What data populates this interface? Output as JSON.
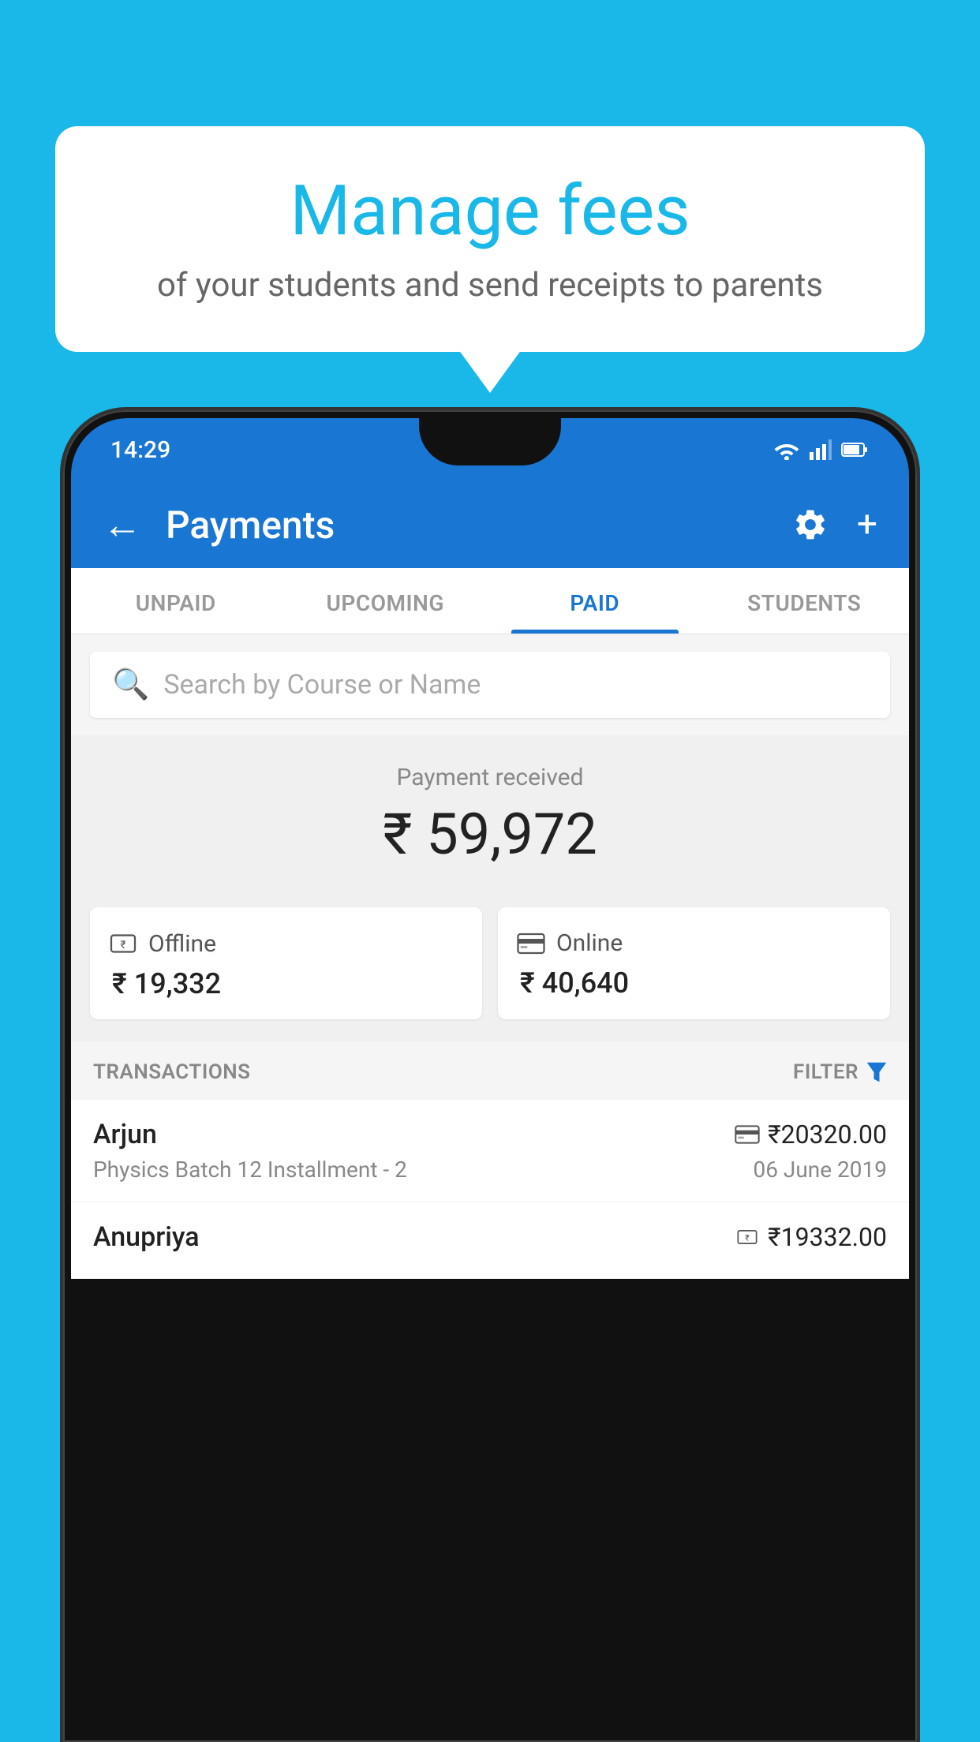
{
  "background": {
    "color": "#1ab8e8"
  },
  "speech_bubble": {
    "title": "Manage fees",
    "subtitle": "of your students and send receipts to parents"
  },
  "status_bar": {
    "time": "14:29",
    "icons": [
      "wifi",
      "signal",
      "battery"
    ]
  },
  "app_bar": {
    "title": "Payments",
    "back_label": "←",
    "settings_label": "⚙",
    "add_label": "+"
  },
  "tabs": [
    {
      "label": "UNPAID",
      "active": false
    },
    {
      "label": "UPCOMING",
      "active": false
    },
    {
      "label": "PAID",
      "active": true
    },
    {
      "label": "STUDENTS",
      "active": false
    }
  ],
  "search": {
    "placeholder": "Search by Course or Name"
  },
  "payment_section": {
    "label": "Payment received",
    "amount": "₹ 59,972",
    "offline": {
      "type": "Offline",
      "amount": "₹ 19,332"
    },
    "online": {
      "type": "Online",
      "amount": "₹ 40,640"
    }
  },
  "transactions_header": {
    "label": "TRANSACTIONS",
    "filter_label": "FILTER"
  },
  "transactions": [
    {
      "name": "Arjun",
      "amount": "₹20320.00",
      "course": "Physics Batch 12 Installment - 2",
      "date": "06 June 2019",
      "payment_type": "online"
    },
    {
      "name": "Anupriya",
      "amount": "₹19332.00",
      "course": "",
      "date": "",
      "payment_type": "offline"
    }
  ]
}
